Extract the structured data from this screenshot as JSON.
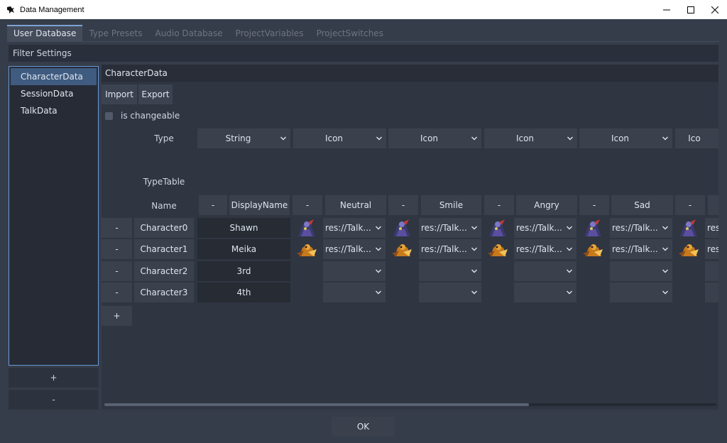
{
  "window": {
    "title": "Data Management"
  },
  "tabs": [
    {
      "label": "User Database"
    },
    {
      "label": "Type Presets"
    },
    {
      "label": "Audio Database"
    },
    {
      "label": "ProjectVariables"
    },
    {
      "label": "ProjectSwitches"
    }
  ],
  "filter": {
    "label": "Filter Settings"
  },
  "sidebar": {
    "items": [
      {
        "label": "CharacterData"
      },
      {
        "label": "SessionData"
      },
      {
        "label": "TalkData"
      }
    ],
    "add_label": "+",
    "remove_label": "-"
  },
  "panel": {
    "title": "CharacterData",
    "import_label": "Import",
    "export_label": "Export",
    "changeable_label": "is changeable",
    "type_label": "Type",
    "typetable_label": "TypeTable",
    "name_label": "Name",
    "column_types": [
      "String",
      "Icon",
      "Icon",
      "Icon",
      "Icon",
      "Ico"
    ],
    "column_names": [
      "DisplayName",
      "Neutral",
      "Smile",
      "Angry",
      "Sad"
    ],
    "minus": "-",
    "add_row_label": "+",
    "resource_text": "res://Talk..."
  },
  "rows": [
    {
      "key": "Character0",
      "display": "Shawn",
      "has_icons": true
    },
    {
      "key": "Character1",
      "display": "Meika",
      "has_icons": true
    },
    {
      "key": "Character2",
      "display": "3rd",
      "has_icons": false
    },
    {
      "key": "Character3",
      "display": "4th",
      "has_icons": false
    }
  ],
  "footer": {
    "ok_label": "OK"
  },
  "colors": {
    "accent": "#6a9ad8",
    "background": "#363d4a",
    "panel": "#2f3541"
  }
}
